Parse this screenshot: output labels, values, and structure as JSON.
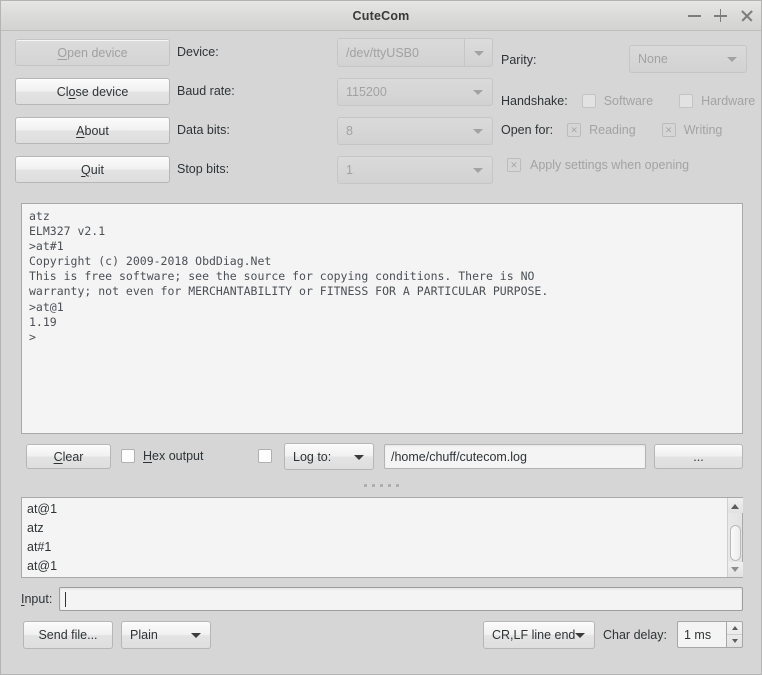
{
  "window": {
    "title": "CuteCom",
    "controls": {
      "minimize": "−",
      "maximize": "+",
      "close": "×"
    }
  },
  "actions": {
    "open_device": "Open device",
    "close_device": "Close device",
    "about": "About",
    "quit": "Quit"
  },
  "settings": {
    "device_label": "Device:",
    "device_value": "/dev/ttyUSB0",
    "baud_label": "Baud rate:",
    "baud_value": "115200",
    "data_bits_label": "Data bits:",
    "data_bits_value": "8",
    "stop_bits_label": "Stop bits:",
    "stop_bits_value": "1",
    "parity_label": "Parity:",
    "parity_value": "None",
    "handshake_label": "Handshake:",
    "handshake_software": "Software",
    "handshake_hardware": "Hardware",
    "open_for_label": "Open for:",
    "open_for_reading": "Reading",
    "open_for_writing": "Writing",
    "apply_settings": "Apply settings when opening"
  },
  "terminal": {
    "text": "atz\nELM327 v2.1\n>at#1\nCopyright (c) 2009-2018 ObdDiag.Net\nThis is free software; see the source for copying conditions. There is NO\nwarranty; not even for MERCHANTABILITY or FITNESS FOR A PARTICULAR PURPOSE.\n>at@1\n1.19\n>"
  },
  "log_bar": {
    "clear": "Clear",
    "hex_output": "Hex output",
    "log_to": "Log to:",
    "log_path": "/home/chuff/cutecom.log",
    "browse": "..."
  },
  "history": {
    "items": [
      "at@1",
      "atz",
      "at#1",
      "at@1"
    ]
  },
  "input": {
    "label": "Input:",
    "value": "",
    "placeholder": ""
  },
  "bottom": {
    "send_file": "Send file...",
    "protocol": "Plain",
    "line_end": "CR,LF line end",
    "char_delay_label": "Char delay:",
    "char_delay_value": "1 ms"
  },
  "colors": {
    "panel": "#d6d6d6",
    "field": "#f4f4f4",
    "text": "#2e3436",
    "disabled_text": "#a2a2a2",
    "terminal_text": "#4b5055",
    "border": "#a9a9a9"
  }
}
